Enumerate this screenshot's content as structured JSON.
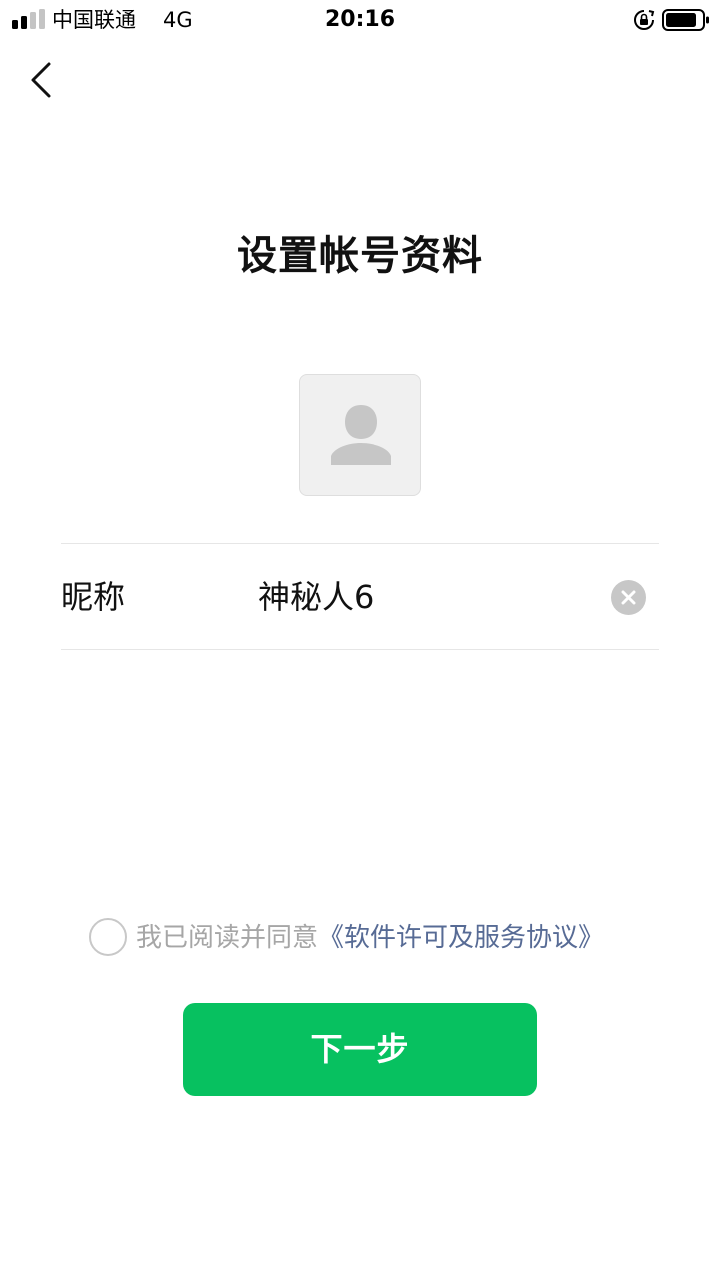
{
  "status_bar": {
    "carrier": "中国联通",
    "network": "4G",
    "time": "20:16",
    "signal_icon": "signal-bars-icon",
    "rotation_lock_icon": "rotation-lock-icon",
    "battery_icon": "battery-icon"
  },
  "nav": {
    "back_icon": "chevron-left-icon"
  },
  "page": {
    "title": "设置帐号资料"
  },
  "avatar": {
    "icon": "person-placeholder-icon"
  },
  "form": {
    "nickname_label": "昵称",
    "nickname_value": "神秘人6",
    "clear_icon": "clear-circle-icon"
  },
  "agreement": {
    "checked": false,
    "prefix": "我已阅读并同意",
    "link": "《软件许可及服务协议》"
  },
  "actions": {
    "next_label": "下一步"
  },
  "colors": {
    "primary": "#07c160",
    "link": "#576b95",
    "muted_text": "#a6a6a6",
    "divider": "#e6e6e6",
    "avatar_bg": "#f0f0f0",
    "clear_icon": "#c7c7c7"
  }
}
